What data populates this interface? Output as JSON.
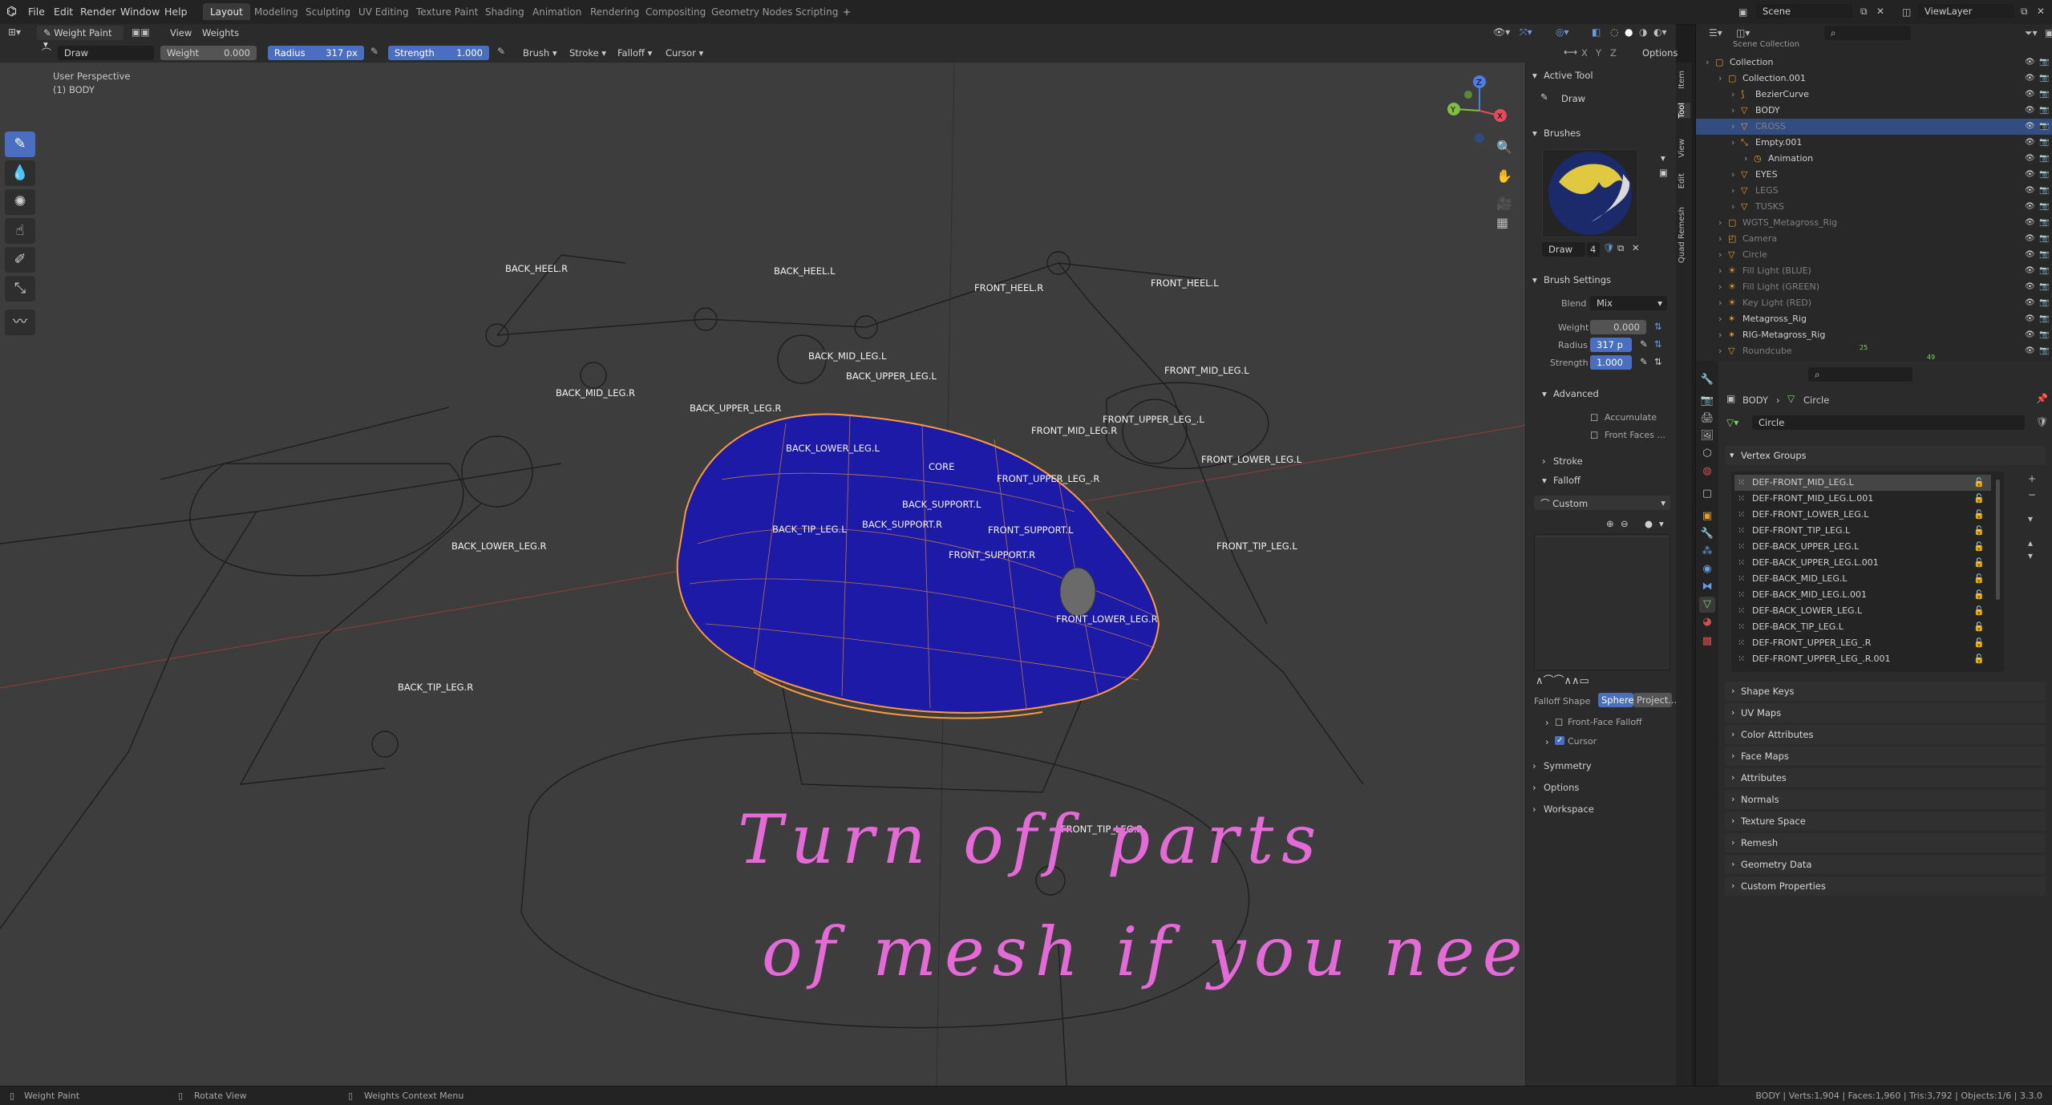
{
  "menubar": {
    "items": [
      "File",
      "Edit",
      "Render",
      "Window",
      "Help"
    ],
    "workspaces": [
      "Layout",
      "Modeling",
      "Sculpting",
      "UV Editing",
      "Texture Paint",
      "Shading",
      "Animation",
      "Rendering",
      "Compositing",
      "Geometry Nodes",
      "Scripting"
    ],
    "active_workspace": "Layout",
    "add_tab": "+",
    "scene": "Scene",
    "view_layer": "ViewLayer"
  },
  "header": {
    "mode": "Weight Paint",
    "view": "View",
    "weights": "Weights",
    "brush_name": "Draw",
    "weight_label": "Weight",
    "weight_value": "0.000",
    "radius_label": "Radius",
    "radius_value": "317 px",
    "strength_label": "Strength",
    "strength_value": "1.000",
    "brush_menu": "Brush",
    "stroke_menu": "Stroke",
    "falloff_menu": "Falloff",
    "cursor_menu": "Cursor",
    "axes": [
      "X",
      "Y",
      "Z"
    ],
    "options": "Options"
  },
  "viewport": {
    "perspective": "User Perspective",
    "object": "(1) BODY",
    "bone_labels": [
      {
        "text": "BACK_HEEL.R"
      },
      {
        "text": "BACK_HEEL.L"
      },
      {
        "text": "FRONT_HEEL.R"
      },
      {
        "text": "FRONT_HEEL.L"
      },
      {
        "text": "BACK_MID_LEG.L"
      },
      {
        "text": "BACK_UPPER_LEG.L"
      },
      {
        "text": "FRONT_MID_LEG.L"
      },
      {
        "text": "BACK_MID_LEG.R"
      },
      {
        "text": "BACK_UPPER_LEG.R"
      },
      {
        "text": "FRONT_MID_LEG.R"
      },
      {
        "text": "FRONT_UPPER_LEG_.L"
      },
      {
        "text": "BACK_LOWER_LEG.L"
      },
      {
        "text": "CORE"
      },
      {
        "text": "FRONT_LOWER_LEG.L"
      },
      {
        "text": "FRONT_UPPER_LEG_.R"
      },
      {
        "text": "BACK_SUPPORT.L"
      },
      {
        "text": "BACK_TIP_LEG.L"
      },
      {
        "text": "BACK_SUPPORT.R"
      },
      {
        "text": "FRONT_SUPPORT.L"
      },
      {
        "text": "BACK_LOWER_LEG.R"
      },
      {
        "text": "FRONT_TIP_LEG.L"
      },
      {
        "text": "FRONT_SUPPORT.R"
      },
      {
        "text": "FRONT_LOWER_LEG.R"
      },
      {
        "text": "BACK_TIP_LEG.R"
      },
      {
        "text": "FRONT_TIP_LEG.R"
      }
    ],
    "handwriting_line1": "Turn off parts",
    "handwriting_line2": "of mesh if you need to"
  },
  "npanel": {
    "active_tool_title": "Active Tool",
    "tool_name": "Draw",
    "brushes_title": "Brushes",
    "brush_name": "Draw",
    "brush_users": "4",
    "brush_settings_title": "Brush Settings",
    "blend_label": "Blend",
    "blend_value": "Mix",
    "weight_label": "Weight",
    "weight_value": "0.000",
    "radius_label": "Radius",
    "radius_value": "317 p",
    "strength_label": "Strength",
    "strength_value": "1.000",
    "advanced_title": "Advanced",
    "accumulate": "Accumulate",
    "front_faces": "Front Faces ...",
    "stroke_title": "Stroke",
    "falloff_title": "Falloff",
    "falloff_preset": "Custom",
    "falloff_shape_label": "Falloff Shape",
    "falloff_shape_sphere": "Sphere",
    "falloff_shape_project": "Project...",
    "front_face_falloff": "Front-Face Falloff",
    "cursor": "Cursor",
    "symmetry_title": "Symmetry",
    "options_title": "Options",
    "workspace_title": "Workspace",
    "tabs": [
      "Item",
      "Tool",
      "View",
      "Edit",
      "Quad Remesh"
    ]
  },
  "outliner": {
    "root": "Scene Collection",
    "rows": [
      {
        "name": "Collection",
        "depth": 0
      },
      {
        "name": "Collection.001",
        "depth": 1
      },
      {
        "name": "BezierCurve",
        "depth": 2
      },
      {
        "name": "BODY",
        "depth": 2
      },
      {
        "name": "CROSS",
        "depth": 2,
        "selected": true
      },
      {
        "name": "Empty.001",
        "depth": 2
      },
      {
        "name": "Animation",
        "depth": 3
      },
      {
        "name": "EYES",
        "depth": 2
      },
      {
        "name": "LEGS",
        "depth": 2
      },
      {
        "name": "TUSKS",
        "depth": 2
      },
      {
        "name": "WGTS_Metagross_Rig",
        "depth": 1
      },
      {
        "name": "Camera",
        "depth": 1
      },
      {
        "name": "Circle",
        "depth": 1
      },
      {
        "name": "Fill Light (BLUE)",
        "depth": 1
      },
      {
        "name": "Fill Light (GREEN)",
        "depth": 1
      },
      {
        "name": "Key Light (RED)",
        "depth": 1
      },
      {
        "name": "Metagross_Rig",
        "depth": 1
      },
      {
        "name": "RIG-Metagross_Rig",
        "depth": 1
      },
      {
        "name": "Roundcube",
        "depth": 1
      }
    ],
    "badge_25": "25",
    "badge_49": "49"
  },
  "properties": {
    "breadcrumb_object": "BODY",
    "breadcrumb_data": "Circle",
    "mesh_name": "Circle",
    "vertex_groups_title": "Vertex Groups",
    "vertex_groups": [
      "DEF-FRONT_MID_LEG.L",
      "DEF-FRONT_MID_LEG.L.001",
      "DEF-FRONT_LOWER_LEG.L",
      "DEF-FRONT_TIP_LEG.L",
      "DEF-BACK_UPPER_LEG.L",
      "DEF-BACK_UPPER_LEG.L.001",
      "DEF-BACK_MID_LEG.L",
      "DEF-BACK_MID_LEG.L.001",
      "DEF-BACK_LOWER_LEG.L",
      "DEF-BACK_TIP_LEG.L",
      "DEF-FRONT_UPPER_LEG_.R",
      "DEF-FRONT_UPPER_LEG_.R.001"
    ],
    "sections": [
      "Shape Keys",
      "UV Maps",
      "Color Attributes",
      "Face Maps",
      "Attributes",
      "Normals",
      "Texture Space",
      "Remesh",
      "Geometry Data",
      "Custom Properties"
    ]
  },
  "statusbar": {
    "left1": "Weight Paint",
    "left2": "Rotate View",
    "left3": "Weights Context Menu",
    "right": "BODY | Verts:1,904 | Faces:1,960 | Tris:3,792 | Objects:1/6 | 3.3.0"
  }
}
